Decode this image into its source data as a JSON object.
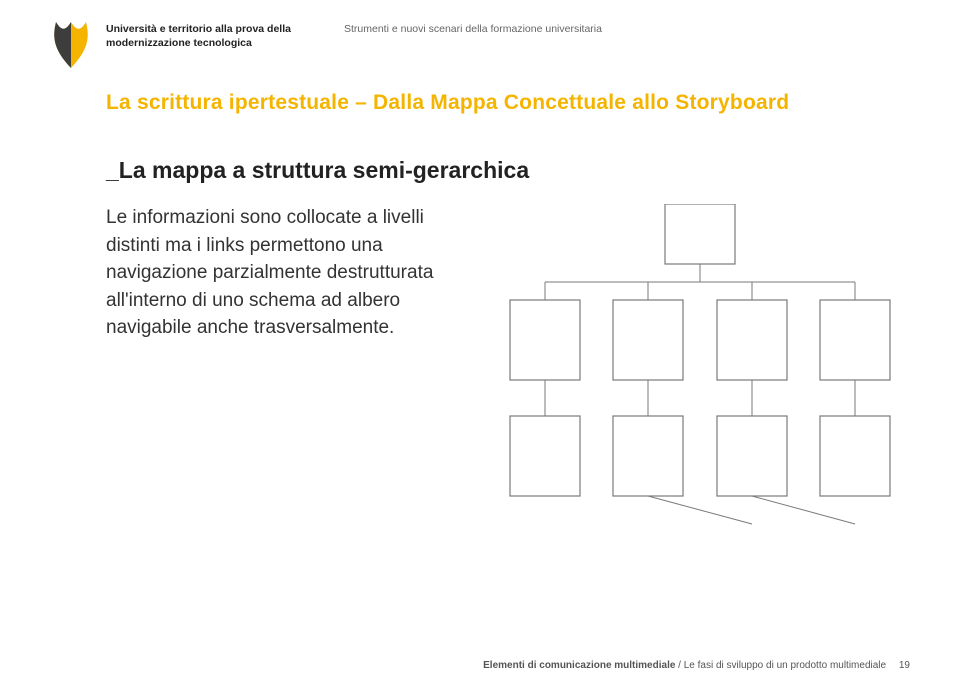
{
  "header": {
    "left_line1": "Università e territorio alla prova della",
    "left_line2": "modernizzazione tecnologica",
    "right": "Strumenti e nuovi scenari della formazione universitaria"
  },
  "title": "La scrittura ipertestuale – Dalla Mappa Concettuale allo Storyboard",
  "subtitle": "_La mappa a struttura semi-gerarchica",
  "body": "Le informazioni sono collocate a livelli distinti ma i links permettono una navigazione parzialmente destrutturata all'interno di uno schema ad albero navigabile anche trasversalmente.",
  "footer": {
    "bold": "Elementi di comunicazione multimediale",
    "rest": " / Le fasi di sviluppo di un prodotto multimediale",
    "page": "19"
  },
  "colors": {
    "accent": "#f4b400",
    "logo_dark": "#3d3d3d"
  }
}
